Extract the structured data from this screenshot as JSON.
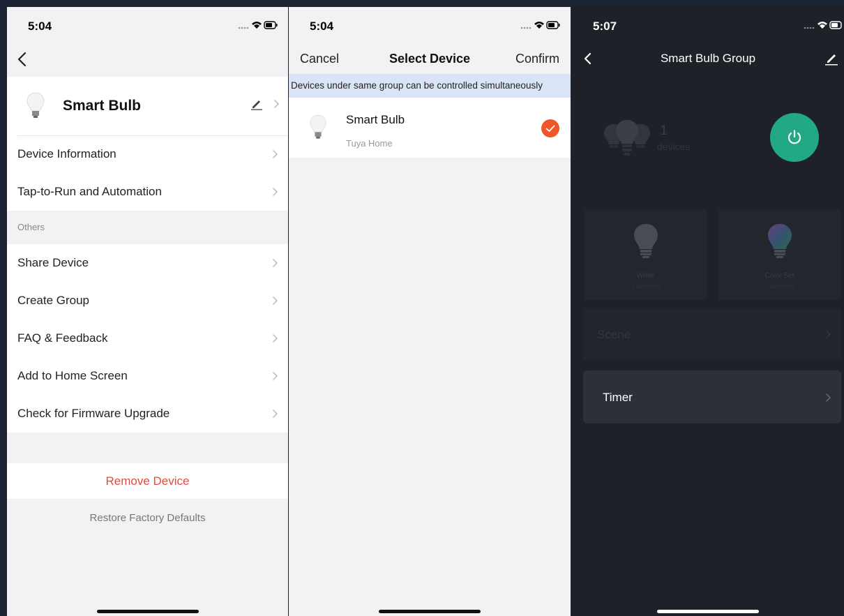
{
  "panel1": {
    "status_time": "5:04",
    "device_name": "Smart Bulb",
    "rows_top": [
      {
        "label": "Device Information"
      },
      {
        "label": "Tap-to-Run and Automation"
      }
    ],
    "section_others": "Others",
    "rows_others": [
      {
        "label": "Share Device"
      },
      {
        "label": "Create Group"
      },
      {
        "label": "FAQ & Feedback"
      },
      {
        "label": "Add to Home Screen"
      },
      {
        "label": "Check for Firmware Upgrade"
      }
    ],
    "remove_label": "Remove Device",
    "restore_label": "Restore Factory Defaults"
  },
  "panel2": {
    "status_time": "5:04",
    "cancel_label": "Cancel",
    "title": "Select Device",
    "confirm_label": "Confirm",
    "info_text": "Devices under same group can be controlled simultaneously",
    "device": {
      "name": "Smart Bulb",
      "home": "Tuya Home",
      "selected": true
    }
  },
  "panel3": {
    "status_time": "5:07",
    "title": "Smart Bulb Group",
    "device_count": "1",
    "device_count_label": "devices",
    "modes": [
      {
        "label": "White",
        "sub": "1 devices"
      },
      {
        "label": "Color Set",
        "sub": "0 devices"
      }
    ],
    "scene_label": "Scene",
    "timer_label": "Timer"
  },
  "colors": {
    "accent_red": "#e64a3a",
    "check_orange": "#f2552c",
    "power_green": "#22a984",
    "info_blue": "#d9e4f7"
  },
  "icons": [
    "signal-icon",
    "wifi-icon",
    "battery-icon",
    "back-chevron-icon",
    "bulb-icon",
    "pencil-icon",
    "chevron-right-icon",
    "check-circle-icon",
    "power-icon"
  ]
}
